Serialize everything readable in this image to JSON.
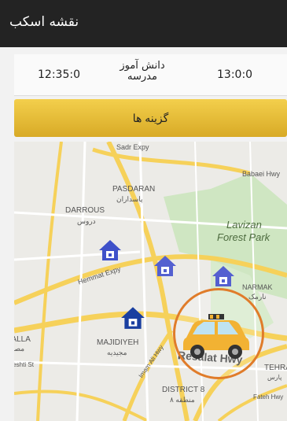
{
  "header": {
    "title": "نقشه اسکب"
  },
  "info": {
    "start_time": "12:35:0",
    "end_time": "13:0:0",
    "student_label": "دانش آموز مدرسه"
  },
  "options_button": {
    "label": "گزینه ها"
  },
  "map": {
    "labels": {
      "sadr": "Sadr Expy",
      "babaei": "Babaei Hwy",
      "pasdaran": "PASDARAN",
      "pasdaran_fa": "پاسداران",
      "darrous": "DARROUS",
      "darrous_fa": "دروس",
      "lavizan1": "Lavizan",
      "lavizan2": "Forest Park",
      "hemmat": "Hemmat Expy",
      "narmak": "NARMAK",
      "narmak_fa": "نارمک",
      "osalla": "OSALLA",
      "osalla_fa": "مصلی",
      "majidiyeh": "MAJIDIYEH",
      "majidiyeh_fa": "مجیدیه",
      "beheshti": "Beheshti St",
      "imam_ali": "Imam Ali Hwy",
      "resalat": "Resalat Hwy",
      "tehran": "TEHRA",
      "tehran_fa": "پارس",
      "district": "DISTRICT 8",
      "district_fa": "منطقه ۸",
      "fateh": "Fateh Hwy"
    },
    "pin_icon": "home-marker-icon",
    "taxi_icon": "taxi-icon",
    "colors": {
      "pin": "#3f51c9",
      "pin_dark": "#1a3fa0",
      "taxi": "#f2b233",
      "ring": "#e07c2a"
    }
  }
}
